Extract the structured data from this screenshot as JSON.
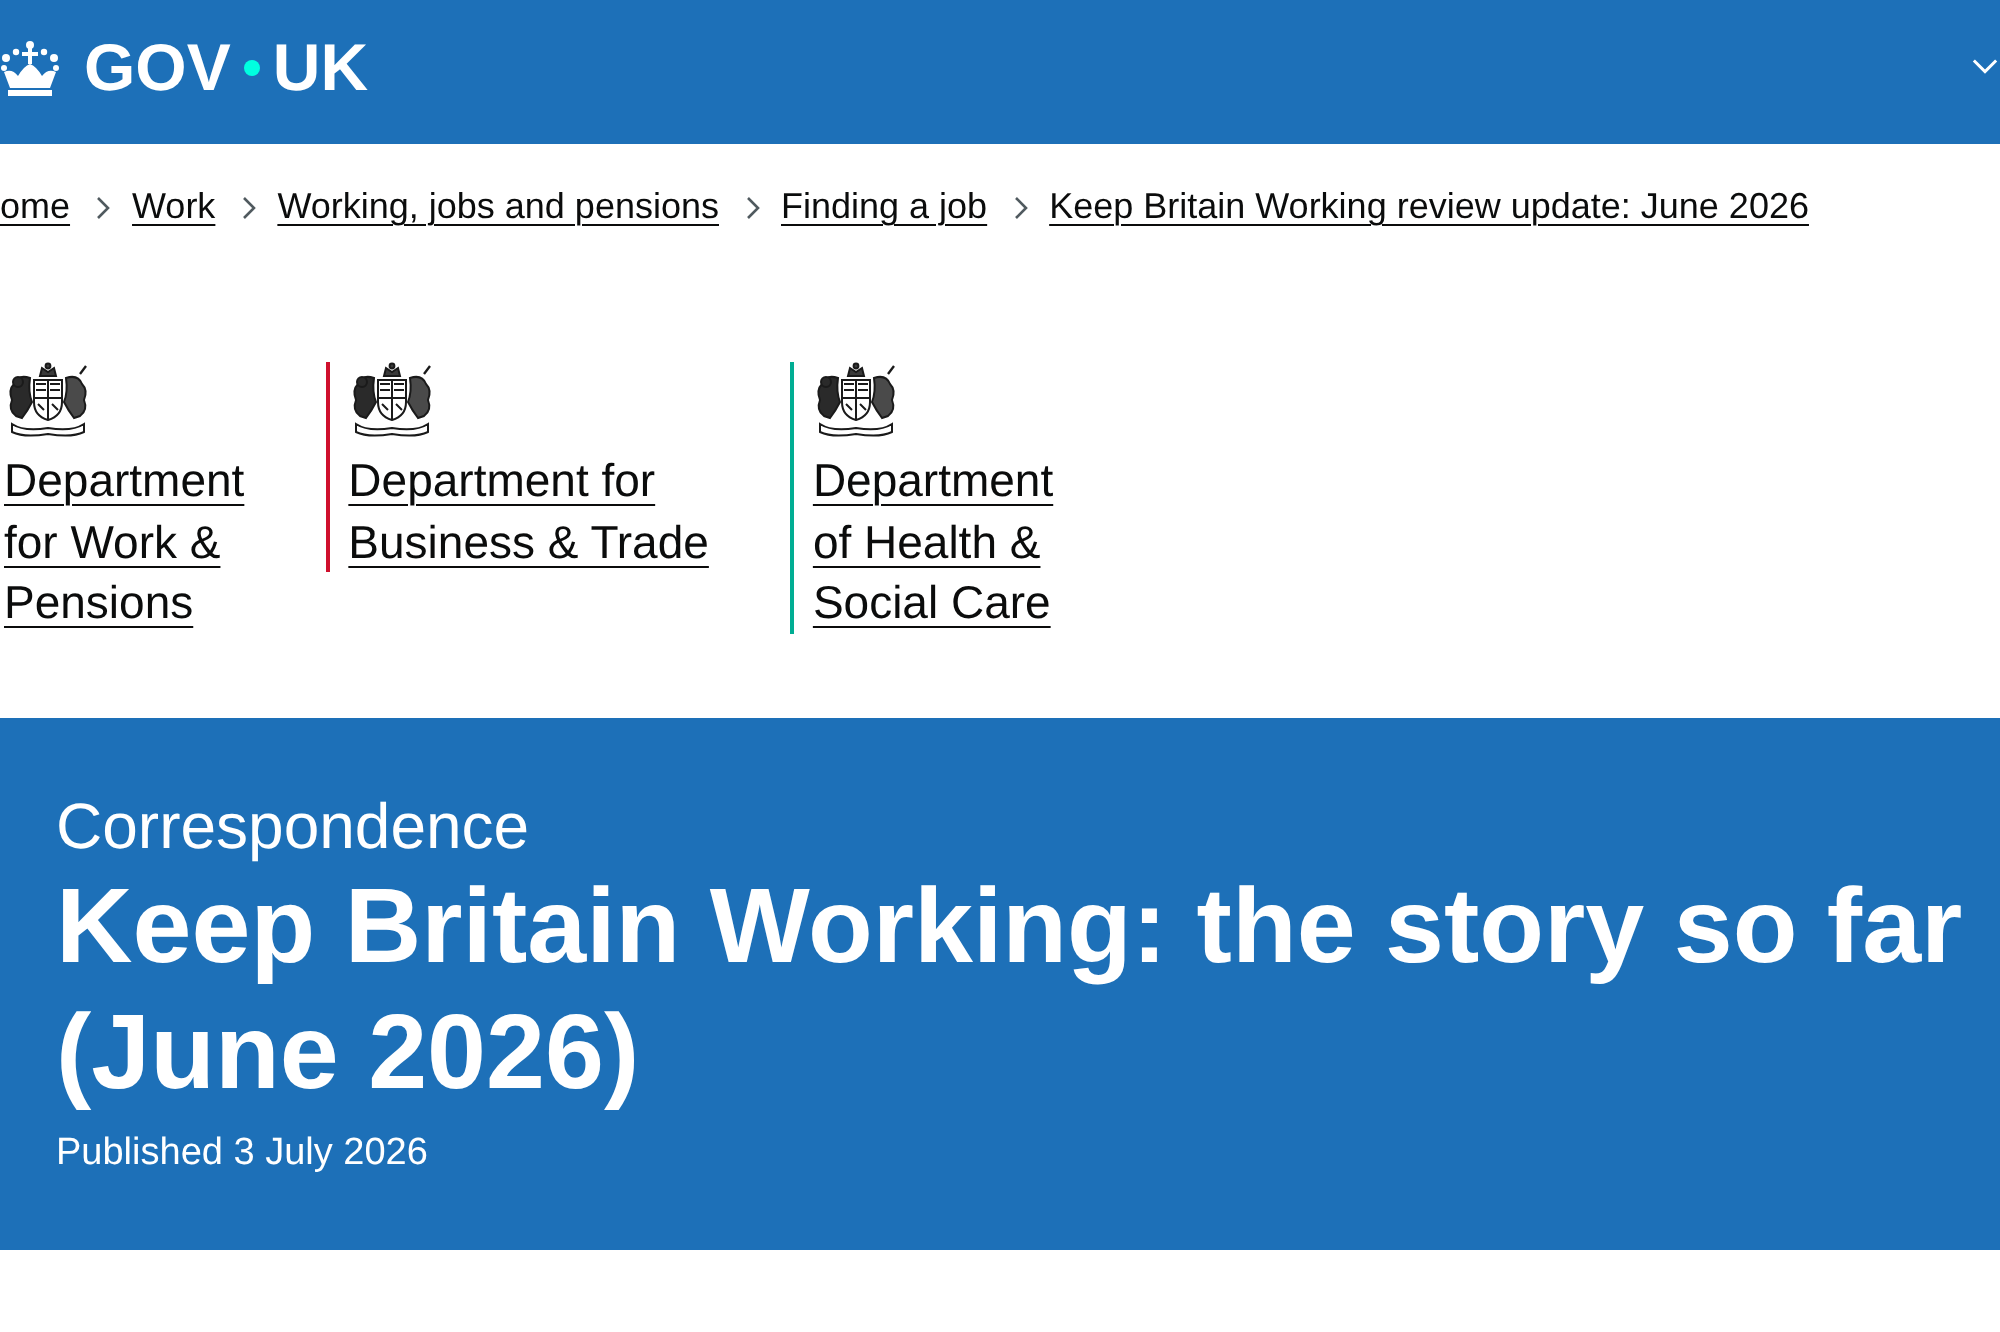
{
  "header": {
    "logo": {
      "left": "GOV",
      "right": "UK"
    }
  },
  "breadcrumbs": [
    "ome",
    "Work",
    "Working, jobs and pensions",
    "Finding a job",
    "Keep Britain Working review update: June 2026"
  ],
  "organisations": [
    {
      "name": "Department\nfor Work &\nPensions"
    },
    {
      "name": "Department for\nBusiness & Trade",
      "color": "#cf102d"
    },
    {
      "name": "Department\nof Health &\nSocial Care",
      "color": "#00ad93"
    }
  ],
  "hero": {
    "caption": "Correspondence",
    "title": "Keep Britain Working: the story so far (June 2026)",
    "published": "Published 3 July 2026"
  }
}
